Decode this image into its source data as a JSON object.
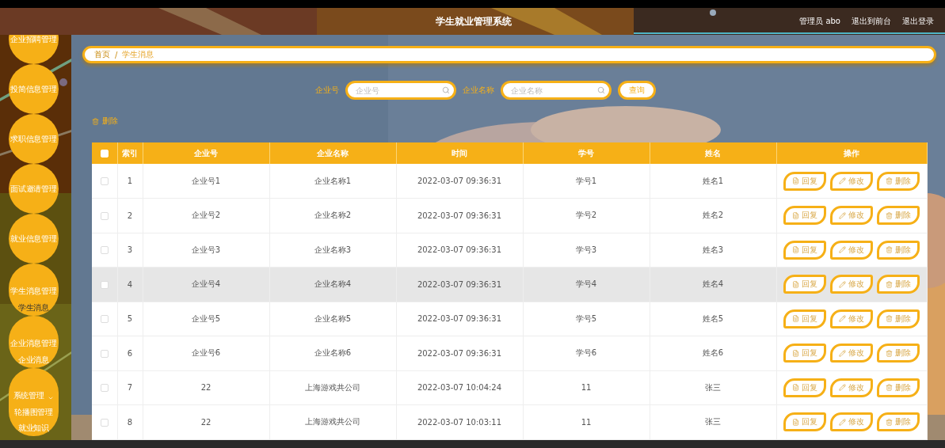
{
  "header": {
    "title": "学生就业管理系统",
    "user": "管理员 abo",
    "links": [
      "退出到前台",
      "退出登录"
    ]
  },
  "sidebar": {
    "items": [
      {
        "label": "企业招聘管理",
        "kind": "menu"
      },
      {
        "label": "投简信息管理",
        "kind": "menu"
      },
      {
        "label": "求职信息管理",
        "kind": "menu"
      },
      {
        "label": "面试邀请管理",
        "kind": "menu"
      },
      {
        "label": "就业信息管理",
        "kind": "menu"
      },
      {
        "label": "学生消息管理",
        "kind": "menu",
        "children": [
          {
            "label": "学生消息",
            "selected": true
          }
        ]
      },
      {
        "label": "企业消息管理",
        "kind": "menu",
        "children": [
          {
            "label": "企业消息",
            "selected": false
          }
        ]
      },
      {
        "label": "系统管理",
        "kind": "submenu",
        "children": [
          {
            "label": "轮播图管理",
            "selected": false
          },
          {
            "label": "就业知识",
            "selected": false
          }
        ]
      }
    ]
  },
  "breadcrumb": {
    "items": [
      "首页",
      "学生消息"
    ],
    "separator": "/"
  },
  "search": {
    "fields": [
      {
        "label": "企业号",
        "placeholder": "企业号"
      },
      {
        "label": "企业名称",
        "placeholder": "企业名称"
      }
    ],
    "button": "查询"
  },
  "toolbar": {
    "delete": "删除"
  },
  "table": {
    "all_checked": false,
    "columns": [
      "索引",
      "企业号",
      "企业名称",
      "时间",
      "学号",
      "姓名",
      "操作"
    ],
    "rows": [
      {
        "checked": false,
        "hovered": false,
        "cells": [
          "1",
          "企业号1",
          "企业名称1",
          "2022-03-07 09:36:31",
          "学号1",
          "姓名1"
        ],
        "actions": [
          "回复",
          "修改",
          "删除"
        ]
      },
      {
        "checked": false,
        "hovered": false,
        "cells": [
          "2",
          "企业号2",
          "企业名称2",
          "2022-03-07 09:36:31",
          "学号2",
          "姓名2"
        ],
        "actions": [
          "回复",
          "修改",
          "删除"
        ]
      },
      {
        "checked": false,
        "hovered": false,
        "cells": [
          "3",
          "企业号3",
          "企业名称3",
          "2022-03-07 09:36:31",
          "学号3",
          "姓名3"
        ],
        "actions": [
          "回复",
          "修改",
          "删除"
        ]
      },
      {
        "checked": false,
        "hovered": true,
        "cells": [
          "4",
          "企业号4",
          "企业名称4",
          "2022-03-07 09:36:31",
          "学号4",
          "姓名4"
        ],
        "actions": [
          "回复",
          "修改",
          "删除"
        ]
      },
      {
        "checked": false,
        "hovered": false,
        "cells": [
          "5",
          "企业号5",
          "企业名称5",
          "2022-03-07 09:36:31",
          "学号5",
          "姓名5"
        ],
        "actions": [
          "回复",
          "修改",
          "删除"
        ]
      },
      {
        "checked": false,
        "hovered": false,
        "cells": [
          "6",
          "企业号6",
          "企业名称6",
          "2022-03-07 09:36:31",
          "学号6",
          "姓名6"
        ],
        "actions": [
          "回复",
          "修改",
          "删除"
        ]
      },
      {
        "checked": false,
        "hovered": false,
        "cells": [
          "7",
          "22",
          "上海游戏共公司",
          "2022-03-07 10:04:24",
          "11",
          "张三"
        ],
        "actions": [
          "回复",
          "修改",
          "删除"
        ]
      },
      {
        "checked": false,
        "hovered": false,
        "cells": [
          "8",
          "22",
          "上海游戏共公司",
          "2022-03-07 10:03:11",
          "11",
          "张三"
        ],
        "actions": [
          "回复",
          "修改",
          "删除"
        ]
      }
    ]
  }
}
